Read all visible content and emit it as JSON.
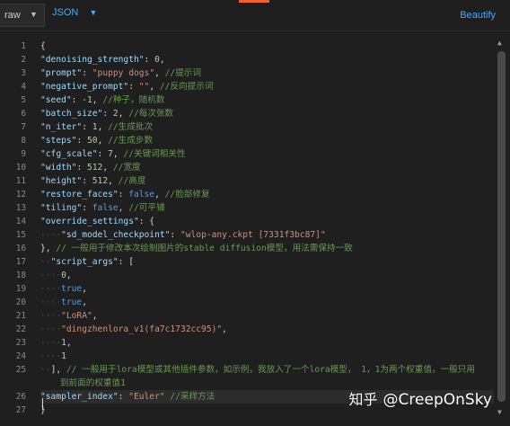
{
  "toolbar": {
    "format_selected": "raw",
    "language_selected": "JSON",
    "beautify_label": "Beautify"
  },
  "colors": {
    "accent": "#f0602a",
    "link": "#4ea8f7",
    "background": "#1f1f1f"
  },
  "icons": {
    "format_chevron": "chevron-down-icon",
    "language_chevron": "chevron-down-icon",
    "scroll_up": "arrow-up-icon",
    "scroll_down": "arrow-down-icon"
  },
  "editor": {
    "line_numbers": [
      "1",
      "2",
      "3",
      "4",
      "5",
      "6",
      "7",
      "8",
      "9",
      "10",
      "11",
      "12",
      "13",
      "14",
      "15",
      "16",
      "17",
      "18",
      "19",
      "20",
      "21",
      "22",
      "23",
      "24",
      "25",
      "",
      "26",
      "27"
    ],
    "lines": [
      [
        [
          "p",
          "{"
        ]
      ],
      [
        [
          "k",
          "\"denoising_strength\""
        ],
        [
          "p",
          ": "
        ],
        [
          "n",
          "0"
        ],
        [
          "p",
          ","
        ]
      ],
      [
        [
          "k",
          "\"prompt\""
        ],
        [
          "p",
          ": "
        ],
        [
          "s",
          "\"puppy dogs\""
        ],
        [
          "p",
          ", "
        ],
        [
          "c",
          "//提示词"
        ]
      ],
      [
        [
          "k",
          "\"negative_prompt\""
        ],
        [
          "p",
          ": "
        ],
        [
          "s",
          "\"\""
        ],
        [
          "p",
          ", "
        ],
        [
          "c",
          "//反向提示词"
        ]
      ],
      [
        [
          "k",
          "\"seed\""
        ],
        [
          "p",
          ": "
        ],
        [
          "n",
          "-1"
        ],
        [
          "p",
          ", "
        ],
        [
          "c",
          "//种子，随机数"
        ]
      ],
      [
        [
          "k",
          "\"batch_size\""
        ],
        [
          "p",
          ": "
        ],
        [
          "n",
          "2"
        ],
        [
          "p",
          ", "
        ],
        [
          "c",
          "//每次张数"
        ]
      ],
      [
        [
          "k",
          "\"n_iter\""
        ],
        [
          "p",
          ": "
        ],
        [
          "n",
          "1"
        ],
        [
          "p",
          ", "
        ],
        [
          "c",
          "//生成批次"
        ]
      ],
      [
        [
          "k",
          "\"steps\""
        ],
        [
          "p",
          ": "
        ],
        [
          "n",
          "50"
        ],
        [
          "p",
          ", "
        ],
        [
          "c",
          "//生成步数"
        ]
      ],
      [
        [
          "k",
          "\"cfg_scale\""
        ],
        [
          "p",
          ": "
        ],
        [
          "n",
          "7"
        ],
        [
          "p",
          ", "
        ],
        [
          "c",
          "//关键词相关性"
        ]
      ],
      [
        [
          "k",
          "\"width\""
        ],
        [
          "p",
          ": "
        ],
        [
          "n",
          "512"
        ],
        [
          "p",
          ", "
        ],
        [
          "c",
          "//宽度"
        ]
      ],
      [
        [
          "k",
          "\"height\""
        ],
        [
          "p",
          ": "
        ],
        [
          "n",
          "512"
        ],
        [
          "p",
          ", "
        ],
        [
          "c",
          "//高度"
        ]
      ],
      [
        [
          "k",
          "\"restore_faces\""
        ],
        [
          "p",
          ": "
        ],
        [
          "b",
          "false"
        ],
        [
          "p",
          ", "
        ],
        [
          "c",
          "//脸部修复"
        ]
      ],
      [
        [
          "k",
          "\"tiling\""
        ],
        [
          "p",
          ": "
        ],
        [
          "b",
          "false"
        ],
        [
          "p",
          ", "
        ],
        [
          "c",
          "//可平铺"
        ]
      ],
      [
        [
          "k",
          "\"override_settings\""
        ],
        [
          "p",
          ": {"
        ]
      ],
      [
        [
          "ws",
          "····"
        ],
        [
          "k",
          "\"sd_model_checkpoint\""
        ],
        [
          "p",
          ": "
        ],
        [
          "s",
          "\"wlop-any.ckpt [7331f3bc87]\""
        ]
      ],
      [
        [
          "p",
          "}, "
        ],
        [
          "c",
          "// 一般用于修改本次绘制图片的stable diffusion模型，用法需保持一致"
        ]
      ],
      [
        [
          "ws",
          "··"
        ],
        [
          "k",
          "\"script_args\""
        ],
        [
          "p",
          ": ["
        ]
      ],
      [
        [
          "ws",
          "····"
        ],
        [
          "n",
          "0"
        ],
        [
          "p",
          ","
        ]
      ],
      [
        [
          "ws",
          "····"
        ],
        [
          "b",
          "true"
        ],
        [
          "p",
          ","
        ]
      ],
      [
        [
          "ws",
          "····"
        ],
        [
          "b",
          "true"
        ],
        [
          "p",
          ","
        ]
      ],
      [
        [
          "ws",
          "····"
        ],
        [
          "s",
          "\"LoRA\""
        ],
        [
          "p",
          ","
        ]
      ],
      [
        [
          "ws",
          "····"
        ],
        [
          "s",
          "\"dingzhenlora_v1(fa7c1732cc95)\""
        ],
        [
          "p",
          ","
        ]
      ],
      [
        [
          "ws",
          "····"
        ],
        [
          "n",
          "1"
        ],
        [
          "p",
          ","
        ]
      ],
      [
        [
          "ws",
          "····"
        ],
        [
          "n",
          "1"
        ]
      ],
      [
        [
          "ws",
          "··"
        ],
        [
          "p",
          "], "
        ],
        [
          "c",
          "// 一般用于lora模型或其他插件参数，如示例，我放入了一个lora模型， 1，1为两个权重值，一般只用"
        ]
      ],
      [
        [
          "c",
          "到前面的权重值1"
        ]
      ],
      [
        [
          "k",
          "\"sampler_index\""
        ],
        [
          "p",
          ": "
        ],
        [
          "s",
          "\"Euler\""
        ],
        [
          "p",
          " "
        ],
        [
          "c",
          "//采样方法"
        ]
      ],
      [
        [
          "p",
          "}"
        ]
      ]
    ]
  },
  "watermark": {
    "site": "知乎",
    "handle": "@CreepOnSky"
  }
}
